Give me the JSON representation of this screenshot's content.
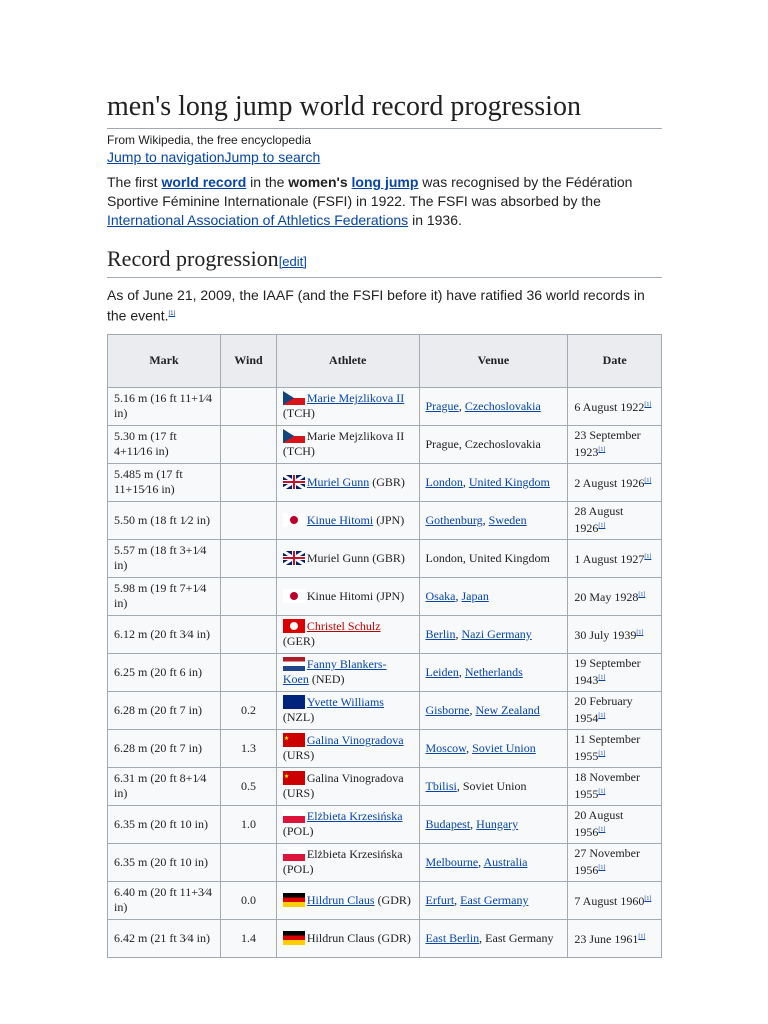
{
  "title": "men's long jump world record progression",
  "subtitle": "From Wikipedia, the free encyclopedia",
  "jump_nav": "Jump to navigation",
  "jump_search": "Jump to search",
  "intro": {
    "t1": "The first ",
    "l1": "world record",
    "t2": " in the ",
    "b1": "women's",
    "t3": " ",
    "l2": "long jump",
    "t4": " was recognised by the Fédération Sportive Féminine Internationale (FSFI) in 1922. The FSFI was absorbed by the ",
    "l3": "International Association of Athletics Federations",
    "t5": " in 1936."
  },
  "section": {
    "title": "Record progression",
    "edit": "[edit]",
    "text": "As of June 21, 2009, the IAAF (and the FSFI before it) have ratified 36 world records in the event.",
    "ref": "[1]"
  },
  "headers": [
    "Mark",
    "Wind",
    "Athlete",
    "Venue",
    "Date"
  ],
  "rows": [
    {
      "mark": "5.16 m (16 ft 11+1⁄4 in)",
      "wind": "",
      "flag": "TCH",
      "athlete": "Marie Mejzlikova II",
      "linked": true,
      "country": "(TCH)",
      "venue": [
        "Prague",
        "Czechoslovakia"
      ],
      "vl": [
        true,
        true
      ],
      "date": "6 August 1922"
    },
    {
      "mark": "5.30 m (17 ft 4+11⁄16 in)",
      "wind": "",
      "flag": "TCH",
      "athlete": "Marie Mejzlikova II",
      "linked": false,
      "country": "(TCH)",
      "venue": [
        "Prague",
        "Czechoslovakia"
      ],
      "vl": [
        false,
        false
      ],
      "date": "23 September 1923"
    },
    {
      "mark": "5.485 m (17 ft 11+15⁄16 in)",
      "wind": "",
      "flag": "GBR",
      "athlete": "Muriel Gunn",
      "linked": true,
      "country": "(GBR)",
      "venue": [
        "London",
        "United Kingdom"
      ],
      "vl": [
        true,
        true
      ],
      "date": "2 August 1926"
    },
    {
      "mark": "5.50 m (18 ft 1⁄2 in)",
      "wind": "",
      "flag": "JPN",
      "athlete": "Kinue Hitomi",
      "linked": true,
      "country": "(JPN)",
      "venue": [
        "Gothenburg",
        "Sweden"
      ],
      "vl": [
        true,
        true
      ],
      "date": "28 August 1926"
    },
    {
      "mark": "5.57 m (18 ft 3+1⁄4 in)",
      "wind": "",
      "flag": "GBR",
      "athlete": "Muriel Gunn",
      "linked": false,
      "country": "(GBR)",
      "venue": [
        "London",
        "United Kingdom"
      ],
      "vl": [
        false,
        false
      ],
      "date": "1 August 1927"
    },
    {
      "mark": "5.98 m (19 ft 7+1⁄4 in)",
      "wind": "",
      "flag": "JPN",
      "athlete": "Kinue Hitomi",
      "linked": false,
      "country": "(JPN)",
      "venue": [
        "Osaka",
        "Japan"
      ],
      "vl": [
        true,
        true
      ],
      "date": "20 May 1928"
    },
    {
      "mark": "6.12 m (20 ft 3⁄4 in)",
      "wind": "",
      "flag": "GER",
      "athlete": "Christel Schulz",
      "linked": true,
      "red": true,
      "country": "(GER)",
      "venue": [
        "Berlin",
        "Nazi Germany"
      ],
      "vl": [
        true,
        true
      ],
      "date": "30 July 1939"
    },
    {
      "mark": "6.25 m (20 ft 6 in)",
      "wind": "",
      "flag": "NED",
      "athlete": "Fanny Blankers-Koen",
      "linked": true,
      "country": "(NED)",
      "venue": [
        "Leiden",
        "Netherlands"
      ],
      "vl": [
        true,
        true
      ],
      "date": "19 September 1943"
    },
    {
      "mark": "6.28 m (20 ft 7 in)",
      "wind": "0.2",
      "flag": "NZL",
      "athlete": "Yvette Williams",
      "linked": true,
      "country": "(NZL)",
      "venue": [
        "Gisborne",
        "New Zealand"
      ],
      "vl": [
        true,
        true
      ],
      "date": "20 February 1954"
    },
    {
      "mark": "6.28 m (20 ft 7 in)",
      "wind": "1.3",
      "flag": "URS",
      "athlete": "Galina Vinogradova",
      "linked": true,
      "country": "(URS)",
      "venue": [
        "Moscow",
        "Soviet Union"
      ],
      "vl": [
        true,
        true
      ],
      "date": "11 September 1955"
    },
    {
      "mark": "6.31 m (20 ft 8+1⁄4 in)",
      "wind": "0.5",
      "flag": "URS",
      "athlete": "Galina Vinogradova",
      "linked": false,
      "country": "(URS)",
      "venue": [
        "Tbilisi",
        "Soviet Union"
      ],
      "vl": [
        true,
        false
      ],
      "date": "18 November 1955"
    },
    {
      "mark": "6.35 m (20 ft 10 in)",
      "wind": "1.0",
      "flag": "POL",
      "athlete": "Elżbieta Krzesińska",
      "linked": true,
      "country": "(POL)",
      "venue": [
        "Budapest",
        "Hungary"
      ],
      "vl": [
        true,
        true
      ],
      "date": "20 August 1956"
    },
    {
      "mark": "6.35 m (20 ft 10 in)",
      "wind": "",
      "flag": "POL",
      "athlete": "Elżbieta Krzesińska",
      "linked": false,
      "country": "(POL)",
      "venue": [
        "Melbourne",
        "Australia"
      ],
      "vl": [
        true,
        true
      ],
      "date": "27 November 1956"
    },
    {
      "mark": "6.40 m (20 ft 11+3⁄4 in)",
      "wind": "0.0",
      "flag": "GDR",
      "athlete": "Hildrun Claus",
      "linked": true,
      "country": "(GDR)",
      "venue": [
        "Erfurt",
        "East Germany"
      ],
      "vl": [
        true,
        true
      ],
      "date": "7 August 1960"
    },
    {
      "mark": "6.42 m (21 ft 3⁄4 in)",
      "wind": "1.4",
      "flag": "GDR",
      "athlete": "Hildrun Claus",
      "linked": false,
      "country": "(GDR)",
      "venue": [
        "East Berlin",
        "East Germany"
      ],
      "vl": [
        true,
        false
      ],
      "date": "23 June 1961"
    }
  ],
  "ref": "[1]"
}
